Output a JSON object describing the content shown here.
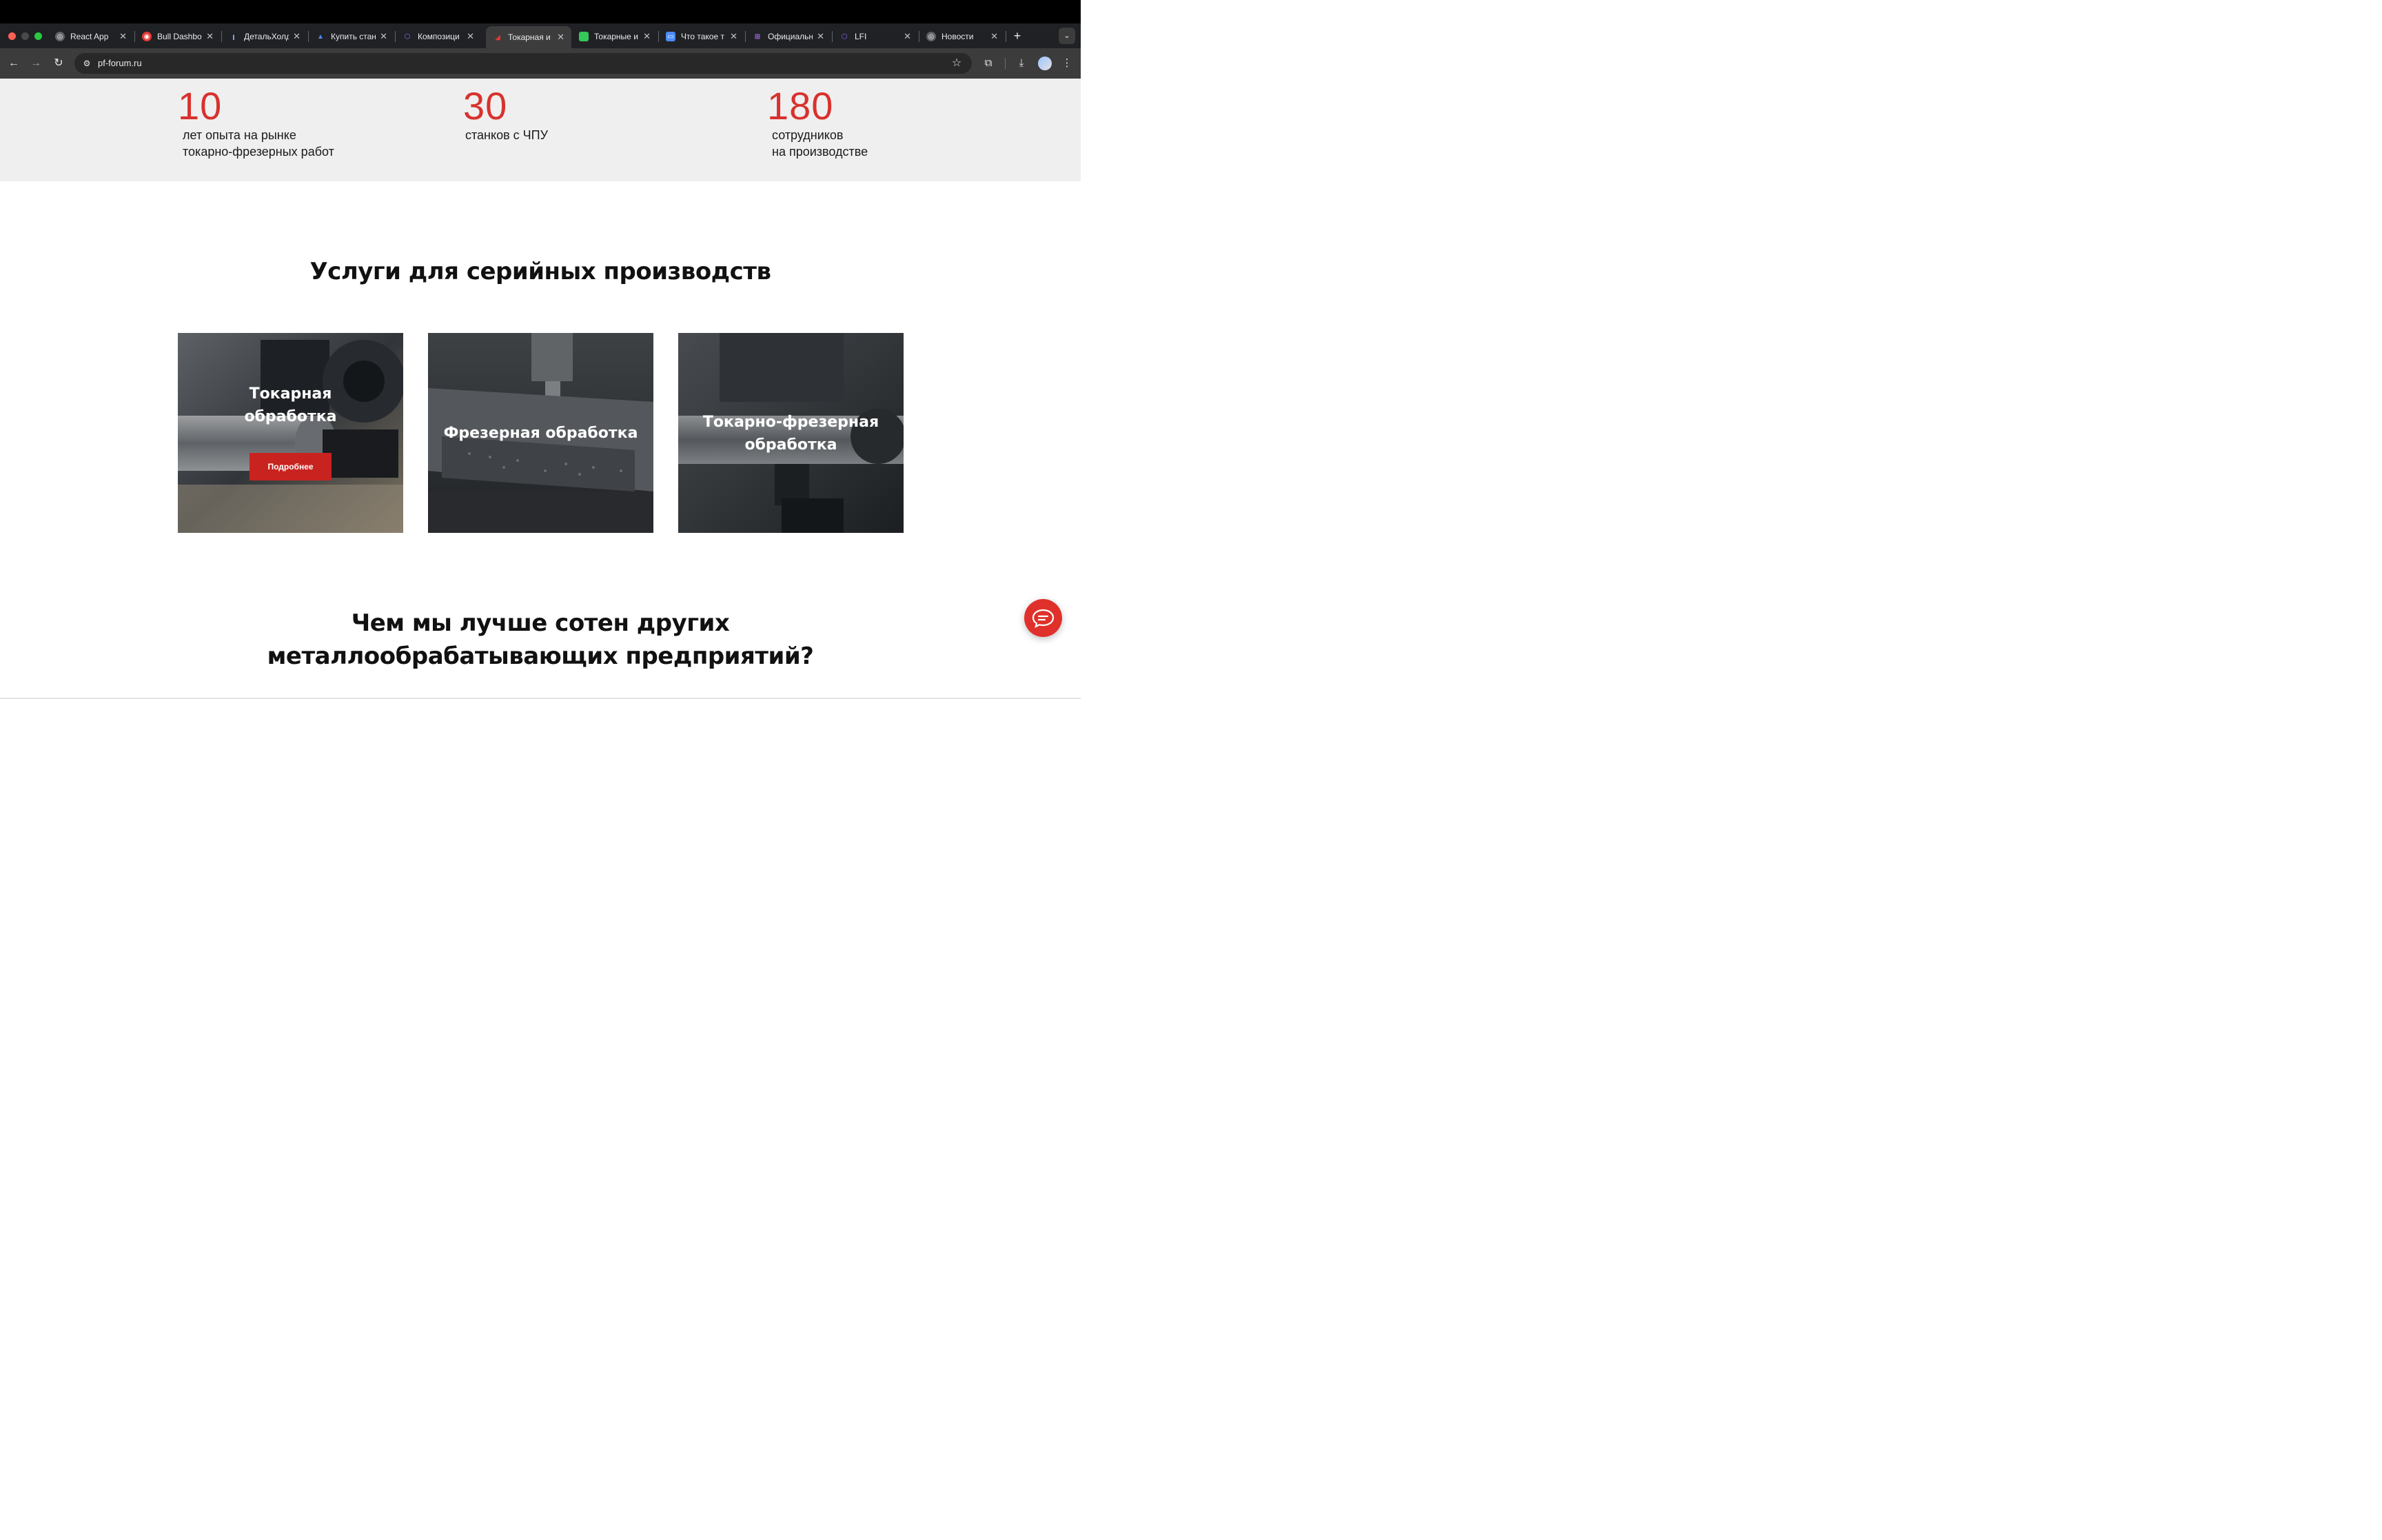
{
  "browser": {
    "tabs": [
      {
        "title": "React App",
        "icon": "globe-icon",
        "active": false
      },
      {
        "title": "Bull Dashbo",
        "icon": "target-icon",
        "active": false
      },
      {
        "title": "ДетальХолд",
        "icon": "detal-icon",
        "active": false
      },
      {
        "title": "Купить стан",
        "icon": "arrow-logo-icon",
        "active": false
      },
      {
        "title": "Композици",
        "icon": "hexagon-icon",
        "active": false
      },
      {
        "title": "Токарная и",
        "icon": "pf-logo-icon",
        "active": true
      },
      {
        "title": "Токарные и",
        "icon": "green-square-icon",
        "active": false
      },
      {
        "title": "Что такое т",
        "icon": "card-icon",
        "active": false
      },
      {
        "title": "Официальн",
        "icon": "grid-icon",
        "active": false
      },
      {
        "title": "LFI",
        "icon": "hexagon-icon",
        "active": false
      },
      {
        "title": "Новости",
        "icon": "globe-icon",
        "active": false
      }
    ],
    "url": "pf-forum.ru"
  },
  "stats": [
    {
      "number": "10",
      "text": "лет опыта на рынке\nтокарно-фрезерных работ"
    },
    {
      "number": "30",
      "text": "станков с ЧПУ"
    },
    {
      "number": "180",
      "text": "сотрудников\nна производстве"
    }
  ],
  "services": {
    "title": "Услуги для серийных производств",
    "cards": [
      {
        "title": "Токарная\nобработка",
        "button": "Подробнее"
      },
      {
        "title": "Фрезерная обработка"
      },
      {
        "title": "Токарно-фрезерная\nобработка"
      }
    ]
  },
  "advantages": {
    "title_line1": "Чем мы лучше сотен других",
    "title_line2": "металлообрабатывающих предприятий?"
  },
  "colors": {
    "accent": "#d8322e",
    "button": "#c8231f",
    "stats_bg": "#efefef"
  }
}
